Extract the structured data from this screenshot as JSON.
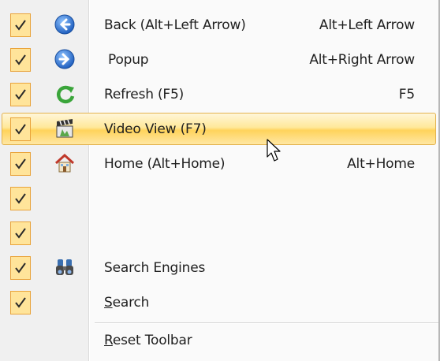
{
  "menu": {
    "items": [
      {
        "label": "Back (Alt+Left Arrow)",
        "shortcut": "Alt+Left Arrow",
        "icon": "back-arrow-icon",
        "checked": true
      },
      {
        "label": "Popup",
        "shortcut": "Alt+Right Arrow",
        "icon": "forward-arrow-icon",
        "checked": true
      },
      {
        "label": "Refresh (F5)",
        "shortcut": "F5",
        "icon": "refresh-icon",
        "checked": true
      },
      {
        "label": "Video View (F7)",
        "shortcut": "",
        "icon": "clapperboard-icon",
        "checked": true,
        "highlighted": true
      },
      {
        "label": "Home (Alt+Home)",
        "shortcut": "Alt+Home",
        "icon": "home-icon",
        "checked": true
      },
      {
        "label": "",
        "shortcut": "",
        "icon": "",
        "checked": true
      },
      {
        "label": "",
        "shortcut": "",
        "icon": "",
        "checked": true
      },
      {
        "label": "Search Engines",
        "shortcut": "",
        "icon": "binoculars-icon",
        "checked": true
      },
      {
        "label": "Search",
        "shortcut": "",
        "icon": "",
        "checked": true
      }
    ],
    "footer": {
      "label": "Reset Toolbar"
    }
  },
  "colors": {
    "check_fill": "#ffe49a",
    "check_border": "#e9a33a",
    "highlight": "#ffd35c"
  }
}
